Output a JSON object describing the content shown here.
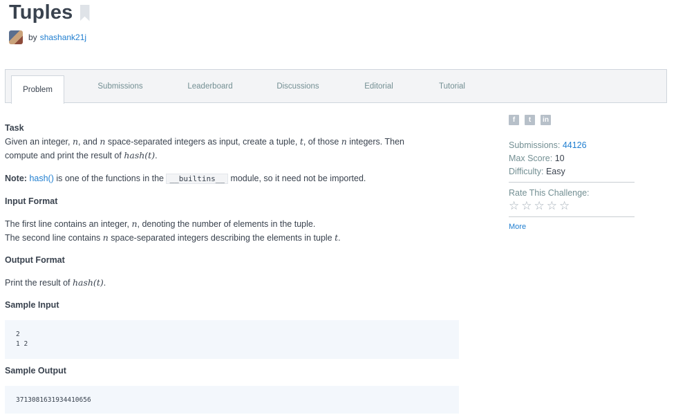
{
  "header": {
    "title": "Tuples",
    "by_label": "by",
    "author": "shashank21j"
  },
  "tabs": [
    "Problem",
    "Submissions",
    "Leaderboard",
    "Discussions",
    "Editorial",
    "Tutorial"
  ],
  "active_tab": 0,
  "problem": {
    "task_heading": "Task",
    "task_line1_a": "Given an integer, ",
    "task_var_n": "n",
    "task_line1_b": ", and ",
    "task_line1_c": " space-separated integers as input, create a tuple, ",
    "task_var_t": "t",
    "task_line1_d": ", of those ",
    "task_line1_e": " integers. Then",
    "task_line2_a": "compute and print the result of ",
    "task_hash_t": "hash(t)",
    "task_line2_b": ".",
    "note_label": "Note:",
    "note_link": "hash()",
    "note_mid": " is one of the functions in the ",
    "note_code": "__builtins__",
    "note_end": " module, so it need not be imported.",
    "input_heading": "Input Format",
    "input_line1_a": "The first line contains an integer, ",
    "input_line1_b": ", denoting the number of elements in the tuple.",
    "input_line2_a": "The second line contains ",
    "input_line2_b": " space-separated integers describing the elements in tuple ",
    "input_line2_c": ".",
    "output_heading": "Output Format",
    "output_line_a": "Print the result of ",
    "output_line_b": ".",
    "sample_input_heading": "Sample Input",
    "sample_input": "2\n1 2",
    "sample_output_heading": "Sample Output",
    "sample_output": "3713081631934410656"
  },
  "sidebar": {
    "social_icons": [
      "facebook-icon",
      "twitter-icon",
      "linkedin-icon"
    ],
    "submissions_label": "Submissions:",
    "submissions_value": "44126",
    "max_score_label": "Max Score:",
    "max_score_value": "10",
    "difficulty_label": "Difficulty:",
    "difficulty_value": "Easy",
    "rate_label": "Rate This Challenge:",
    "rating": 0,
    "rating_max": 5,
    "more_label": "More"
  },
  "colors": {
    "link": "#1f7ed0",
    "text": "#39424e",
    "muted": "#738f93"
  }
}
